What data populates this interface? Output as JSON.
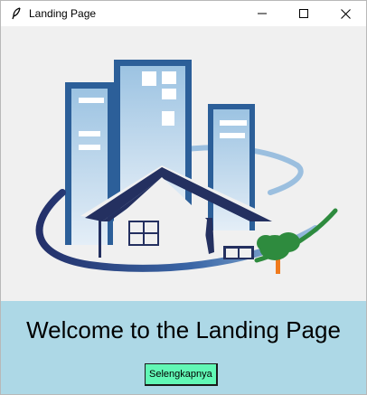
{
  "window": {
    "title": "Landing Page",
    "app_icon": "feather-icon",
    "controls": [
      "minimize-icon",
      "maximize-icon",
      "close-icon"
    ]
  },
  "main": {
    "logo": "building-house-logo"
  },
  "footer": {
    "headline": "Welcome to the Landing Page",
    "button_label": "Selengkapnya",
    "background_color": "#add8e6",
    "button_color": "#61f7b5"
  }
}
